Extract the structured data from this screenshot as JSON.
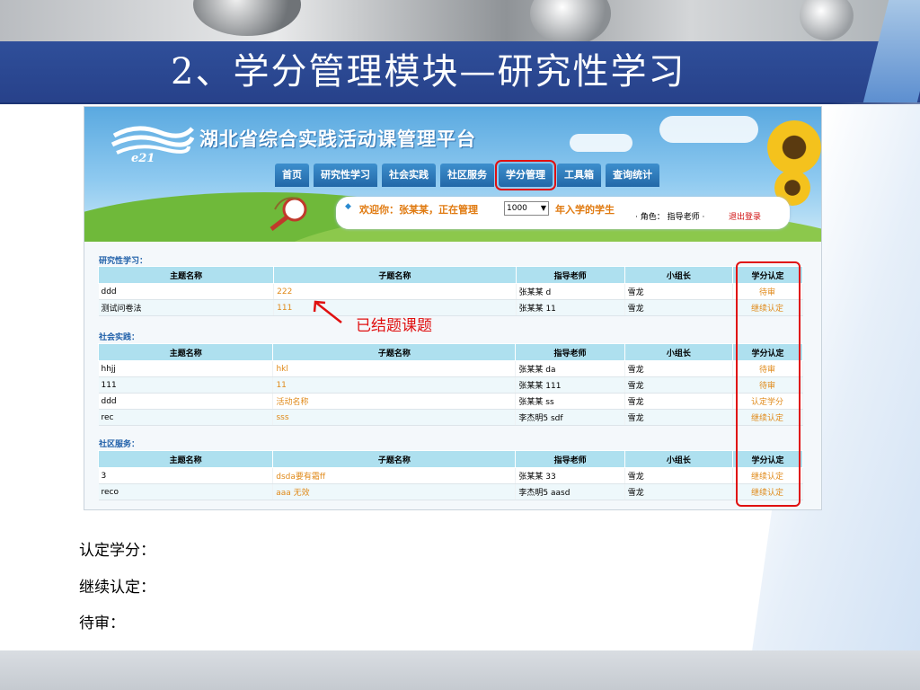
{
  "slide": {
    "title": "2、学分管理模块—研究性学习",
    "legend": [
      "认定学分：",
      "继续认定：",
      "待审："
    ]
  },
  "app": {
    "logo_text": "e21",
    "platform_name": "湖北省综合实践活动课管理平台",
    "nav": [
      {
        "label": "首页",
        "active": false
      },
      {
        "label": "研究性学习",
        "active": false
      },
      {
        "label": "社会实践",
        "active": false
      },
      {
        "label": "社区服务",
        "active": false
      },
      {
        "label": "学分管理",
        "active": true
      },
      {
        "label": "工具箱",
        "active": false
      },
      {
        "label": "查询统计",
        "active": false
      }
    ],
    "welcome": {
      "icon": "diamond-bullet-icon",
      "text": "欢迎你：张某某，正在管理",
      "year": "1000",
      "suffix": "年入学的学生",
      "role": "· 角色： 指导老师 ·",
      "logout": "退出登录"
    }
  },
  "columns": [
    "主题名称",
    "子题名称",
    "指导老师",
    "小组长",
    "学分认定"
  ],
  "sections": [
    {
      "title": "研究性学习：",
      "rows": [
        [
          "ddd",
          "222",
          "张某某 d",
          "雪龙",
          "待审"
        ],
        [
          "测试问卷法",
          "111",
          "张某某 11",
          "雪龙",
          "继续认定"
        ]
      ]
    },
    {
      "title": "社会实践：",
      "rows": [
        [
          "hhjj",
          "hkl",
          "张某某 da",
          "雪龙",
          "待审"
        ],
        [
          "111",
          "11",
          "张某某 111",
          "雪龙",
          "待审"
        ],
        [
          "ddd",
          "活动名称",
          "张某某 ss",
          "雪龙",
          "认定学分"
        ],
        [
          "rec",
          "sss",
          "李杰明5 sdf",
          "雪龙",
          "继续认定"
        ]
      ]
    },
    {
      "title": "社区服务：",
      "rows": [
        [
          "3",
          "dsda要有霜ff",
          "张某某 33",
          "雪龙",
          "继续认定"
        ],
        [
          "reco",
          "aaa 无效",
          "李杰明5 aasd",
          "雪龙",
          "继续认定"
        ]
      ]
    }
  ],
  "annotation": {
    "note": "已结题课题",
    "color": "#e01010"
  }
}
